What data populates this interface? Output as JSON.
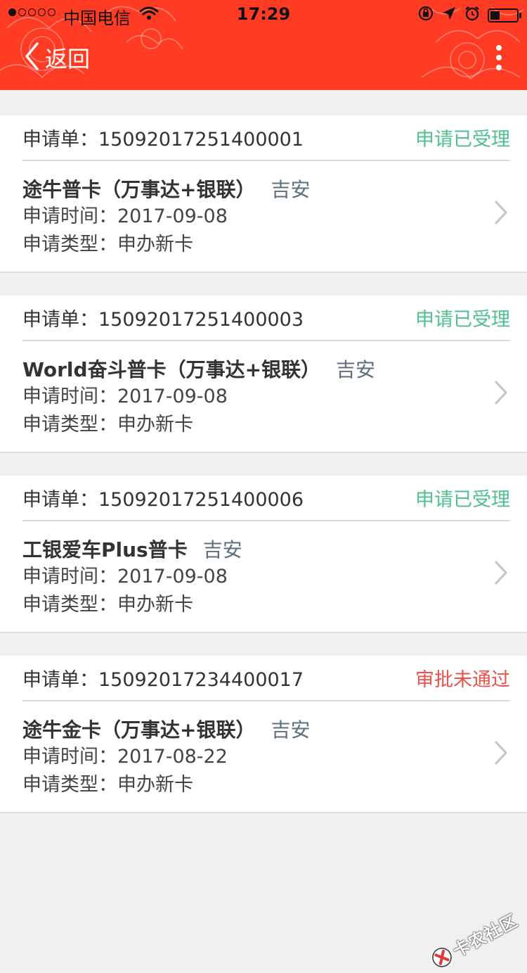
{
  "status_bar": {
    "carrier": "中国电信",
    "time": "17:29",
    "battery_level": 0.35
  },
  "nav": {
    "back_label": "返回"
  },
  "labels": {
    "order_prefix": "申请单：",
    "time_prefix": "申请时间：",
    "type_prefix": "申请类型："
  },
  "applications": [
    {
      "order_no": "1509201725140000 1",
      "order_display": "申请单：15092017251400001",
      "status": "申请已受理",
      "status_kind": "ok",
      "card_name": "途牛普卡（万事达+银联）",
      "city": "吉安",
      "apply_time": "申请时间：2017-09-08",
      "apply_type": "申请类型：申办新卡"
    },
    {
      "order_display": "申请单：15092017251400003",
      "status": "申请已受理",
      "status_kind": "ok",
      "card_name": "World奋斗普卡（万事达+银联）",
      "city": "吉安",
      "apply_time": "申请时间：2017-09-08",
      "apply_type": "申请类型：申办新卡"
    },
    {
      "order_display": "申请单：15092017251400006",
      "status": "申请已受理",
      "status_kind": "ok",
      "card_name": "工银爱车Plus普卡",
      "city": "吉安",
      "apply_time": "申请时间：2017-09-08",
      "apply_type": "申请类型：申办新卡"
    },
    {
      "order_display": "申请单：15092017234400017",
      "status": "审批未通过",
      "status_kind": "fail",
      "card_name": "途牛金卡（万事达+银联）",
      "city": "吉安",
      "apply_time": "申请时间：2017-08-22",
      "apply_type": "申请类型：申办新卡"
    }
  ],
  "watermark": {
    "text": "卡农社区"
  },
  "colors": {
    "header": "#ff3b24",
    "status_ok": "#4fc18c",
    "status_fail": "#f0504a",
    "city": "#5d6f7f",
    "background": "#f0f0f0"
  }
}
